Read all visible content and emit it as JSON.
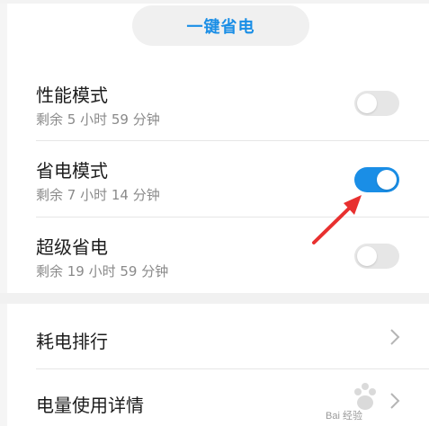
{
  "header": {
    "one_key_label": "一键省电"
  },
  "modes": [
    {
      "title": "性能模式",
      "remaining": "剩余 5 小时 59 分钟",
      "enabled": false
    },
    {
      "title": "省电模式",
      "remaining": "剩余 7 小时 14 分钟",
      "enabled": true
    },
    {
      "title": "超级省电",
      "remaining": "剩余 19 小时 59 分钟",
      "enabled": false
    }
  ],
  "menu": {
    "consumption_ranking": "耗电排行",
    "usage_details": "电量使用详情"
  },
  "colors": {
    "accent": "#1a8ee6",
    "arrow": "#e8302f",
    "toggle_off": "#e6e6e6"
  },
  "watermark_text": "Bai 经验"
}
